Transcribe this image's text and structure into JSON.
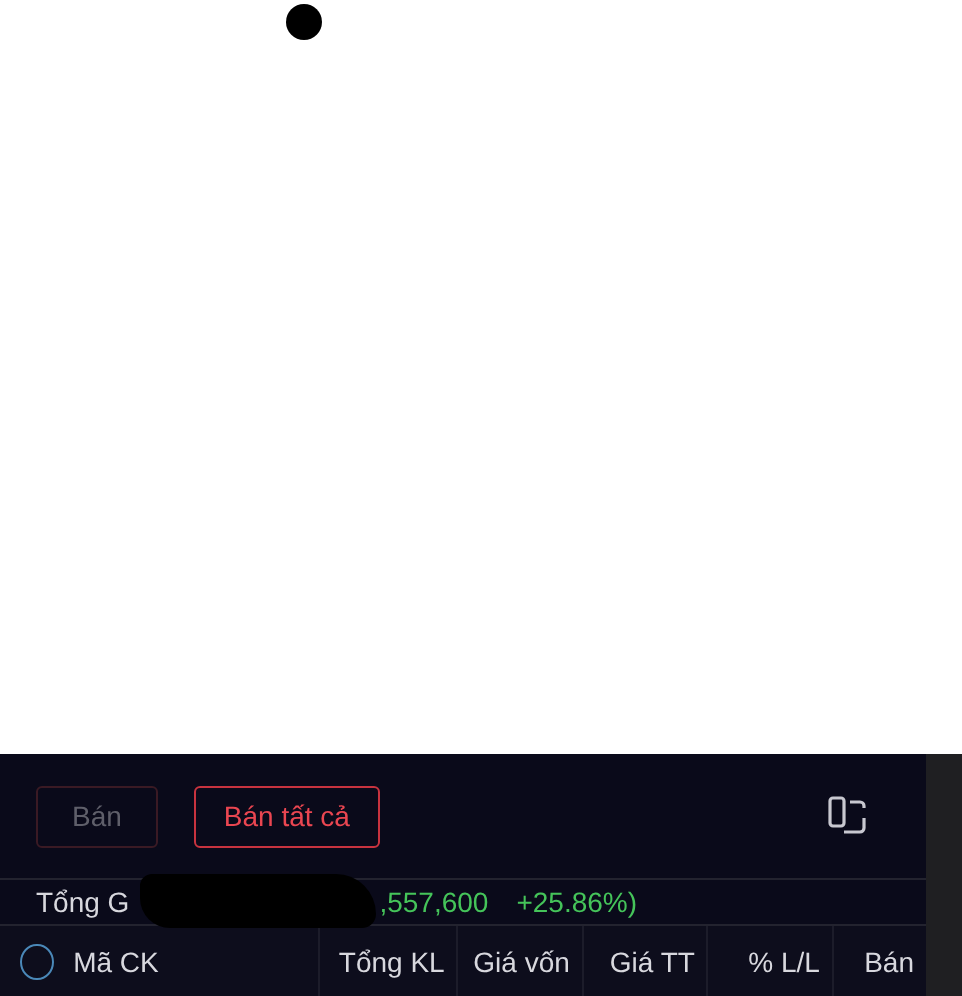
{
  "actions": [
    {
      "label": "Bán",
      "disabled": true
    },
    {
      "label": "Bán tất cả",
      "disabled": false
    }
  ],
  "summary": {
    "label": "Tổng G",
    "value": ",557,600",
    "change": "+25.86%)"
  },
  "table": {
    "select_all": {
      "checked": false
    },
    "columns": [
      {
        "label": "Mã CK"
      },
      {
        "label": "Tổng KL"
      },
      {
        "label": "Giá vốn"
      },
      {
        "label": "Giá TT"
      },
      {
        "label": "% L/L"
      },
      {
        "label": "Bán"
      }
    ]
  }
}
